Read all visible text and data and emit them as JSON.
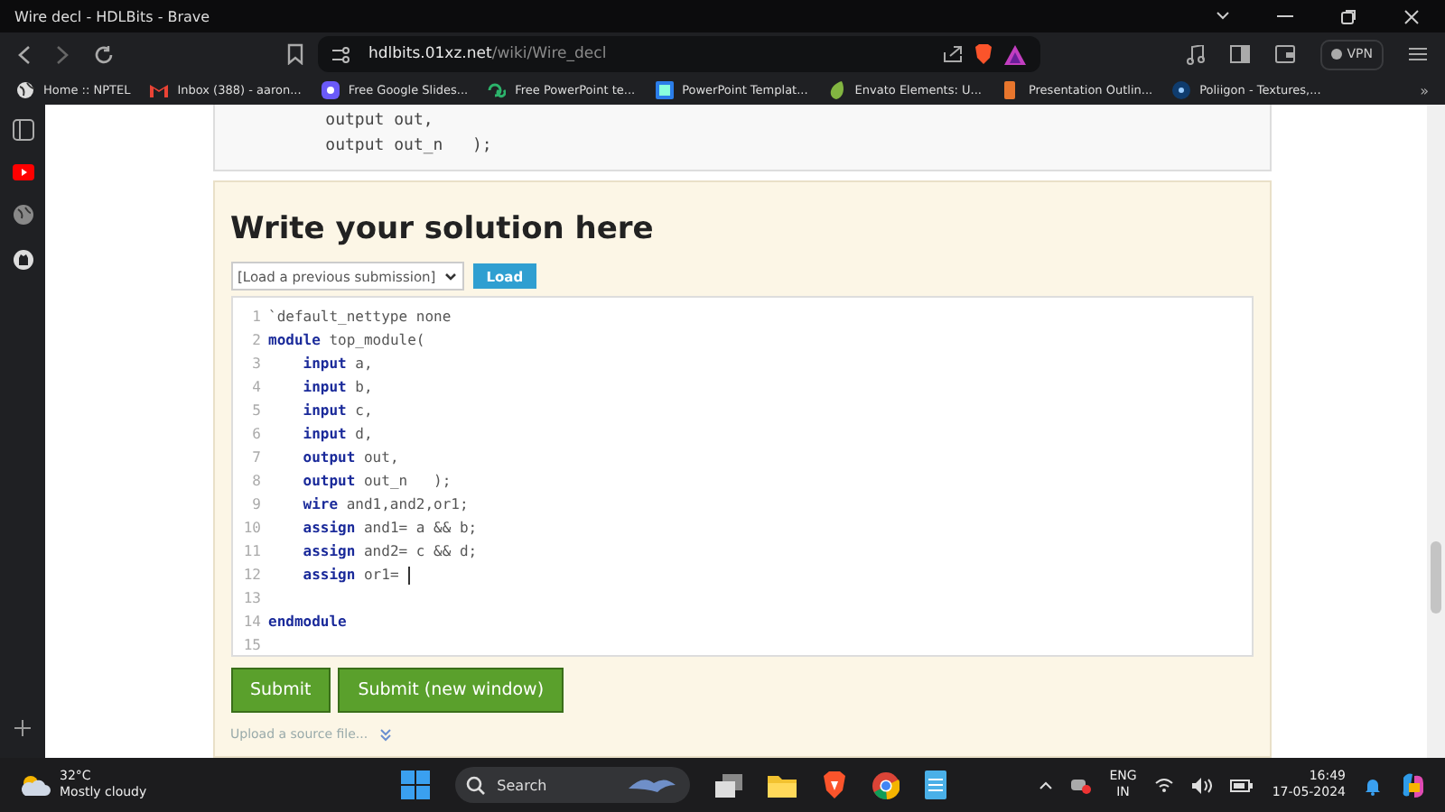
{
  "window": {
    "title": "Wire decl - HDLBits - Brave"
  },
  "address_bar": {
    "host": "hdlbits.01xz.net",
    "path": "/wiki/Wire_decl"
  },
  "vpn_button": {
    "label": "VPN"
  },
  "bookmarks": [
    {
      "label": "Home :: NPTEL"
    },
    {
      "label": "Inbox (388) - aaron..."
    },
    {
      "label": "Free Google Slides..."
    },
    {
      "label": "Free PowerPoint te..."
    },
    {
      "label": "PowerPoint Templat..."
    },
    {
      "label": "Envato Elements: U..."
    },
    {
      "label": "Presentation Outlin..."
    },
    {
      "label": "Poliigon - Textures,..."
    }
  ],
  "bookmarks_overflow": "»",
  "problem_code": [
    "    output out,",
    "    output out_n   );"
  ],
  "solution": {
    "title": "Write your solution here",
    "submission_select": {
      "value": "[Load a previous submission]"
    },
    "load_button": "Load",
    "editor_lines": [
      {
        "number": "1",
        "text": "`default_nettype none",
        "cursor": false
      },
      {
        "number": "2",
        "text": "**module** top_module(",
        "cursor": false
      },
      {
        "number": "3",
        "text": "    **input** a,",
        "cursor": false
      },
      {
        "number": "4",
        "text": "    **input** b,",
        "cursor": false
      },
      {
        "number": "5",
        "text": "    **input** c,",
        "cursor": false
      },
      {
        "number": "6",
        "text": "    **input** d,",
        "cursor": false
      },
      {
        "number": "7",
        "text": "    **output** out,",
        "cursor": false
      },
      {
        "number": "8",
        "text": "    **output** out_n   );",
        "cursor": false
      },
      {
        "number": "9",
        "text": "    **wire** and1,and2,or1;",
        "cursor": false
      },
      {
        "number": "10",
        "text": "    **assign** and1= a && b;",
        "cursor": false
      },
      {
        "number": "11",
        "text": "    **assign** and2= c && d;",
        "cursor": false
      },
      {
        "number": "12",
        "text": "    **assign** or1= ",
        "cursor": true
      },
      {
        "number": "13",
        "cursor": false
      },
      {
        "number": "14",
        "text": "**endmodule**",
        "cursor": false
      },
      {
        "number": "15",
        "cursor": false
      }
    ],
    "buttons": [
      "Submit",
      "Submit (new window)"
    ],
    "upload_link": "Upload a source file..."
  },
  "taskbar": {
    "temperature": "32°C",
    "weather": "Mostly cloudy",
    "search_placeholder": "Search",
    "language": "ENG",
    "region": "IN",
    "time": "16:49",
    "date": "17-05-2024"
  }
}
